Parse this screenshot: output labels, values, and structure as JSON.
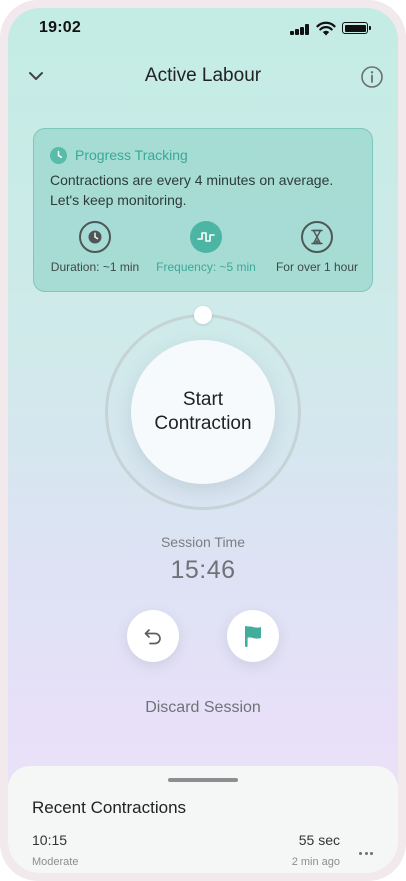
{
  "status_bar": {
    "time": "19:02"
  },
  "header": {
    "title": "Active Labour"
  },
  "progress_card": {
    "title": "Progress Tracking",
    "message_line1": "Contractions are every 4 minutes on average.",
    "message_line2": "Let's keep monitoring.",
    "metrics": [
      {
        "label": "Duration: ~1 min",
        "icon": "clock-icon"
      },
      {
        "label": "Frequency: ~5 min",
        "icon": "pulse-icon"
      },
      {
        "label": "For over 1 hour",
        "icon": "hourglass-icon"
      }
    ]
  },
  "start_button": {
    "line1": "Start",
    "line2": "Contraction"
  },
  "session": {
    "label": "Session Time",
    "time": "15:46"
  },
  "actions": {
    "undo_icon": "undo-icon",
    "flag_icon": "flag-icon"
  },
  "discard_label": "Discard Session",
  "recent": {
    "title": "Recent Contractions",
    "items": [
      {
        "time": "10:15",
        "intensity": "Moderate",
        "duration": "55 sec",
        "ago": "2 min ago"
      }
    ]
  },
  "colors": {
    "accent": "#4cb5a4",
    "accent_text": "#3ba896"
  }
}
